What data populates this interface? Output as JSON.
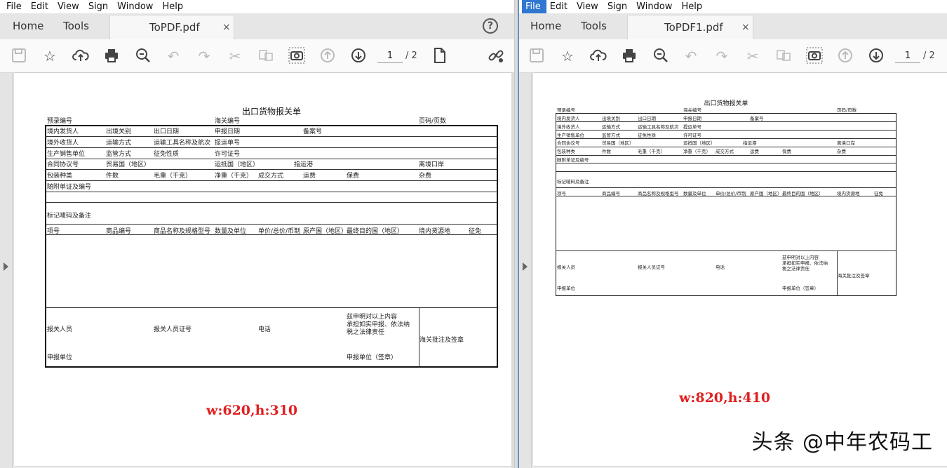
{
  "left_window": {
    "menu": [
      "File",
      "Edit",
      "View",
      "Sign",
      "Window",
      "Help"
    ],
    "nav": {
      "home": "Home",
      "tools": "Tools"
    },
    "tab": {
      "name": "ToPDF.pdf",
      "close": "×"
    },
    "help": "?",
    "page": {
      "current": "1",
      "total": "/ 2"
    },
    "note": "w:620,h:310"
  },
  "right_window": {
    "menu": [
      "File",
      "Edit",
      "View",
      "Sign",
      "Window",
      "Help"
    ],
    "nav": {
      "home": "Home",
      "tools": "Tools"
    },
    "tab": {
      "name": "ToPDF1.pdf",
      "close": "×"
    },
    "page": {
      "current": "1",
      "total": "/ 2"
    },
    "note": "w:820,h:410"
  },
  "form": {
    "title": "出口货物报关单",
    "pre_no": "预录编号",
    "customs_no": "海关编号",
    "page_no": "页码/页数",
    "r1": [
      "境内发货人",
      "出境关别",
      "出口日期",
      "申报日期",
      "备案号"
    ],
    "r2": [
      "境外收货人",
      "运输方式",
      "运输工具名称及航次",
      "提运单号"
    ],
    "r3": [
      "生产销售单位",
      "监管方式",
      "征免性质",
      "许可证号"
    ],
    "r4": [
      "合同协议号",
      "贸易国（地区）",
      "运抵国（地区）",
      "指运港",
      "离境口岸"
    ],
    "r5": [
      "包装种类",
      "件数",
      "毛重（千克）",
      "净重（千克）",
      "成交方式",
      "运费",
      "保费",
      "杂费"
    ],
    "r6": "随附单证及编号",
    "r7": "标记唛码及备注",
    "r8": [
      "项号",
      "商品编号",
      "商品名称及规格型号",
      "数量及单位",
      "单价/总价/币制",
      "原产国（地区）",
      "最终目的国（地区）",
      "境内货源地",
      "征免"
    ],
    "declarer": "报关人员",
    "declarer_cert": "报关人员证号",
    "phone": "电话",
    "statement": [
      "兹申明对以上内容",
      "承担如实申报、依法纳",
      "税之法律责任"
    ],
    "customs_approve": "海关批注及签章",
    "unit": "申报单位",
    "unit_sign": "申报单位（签章）"
  },
  "watermark": "头条 @中年农码工"
}
